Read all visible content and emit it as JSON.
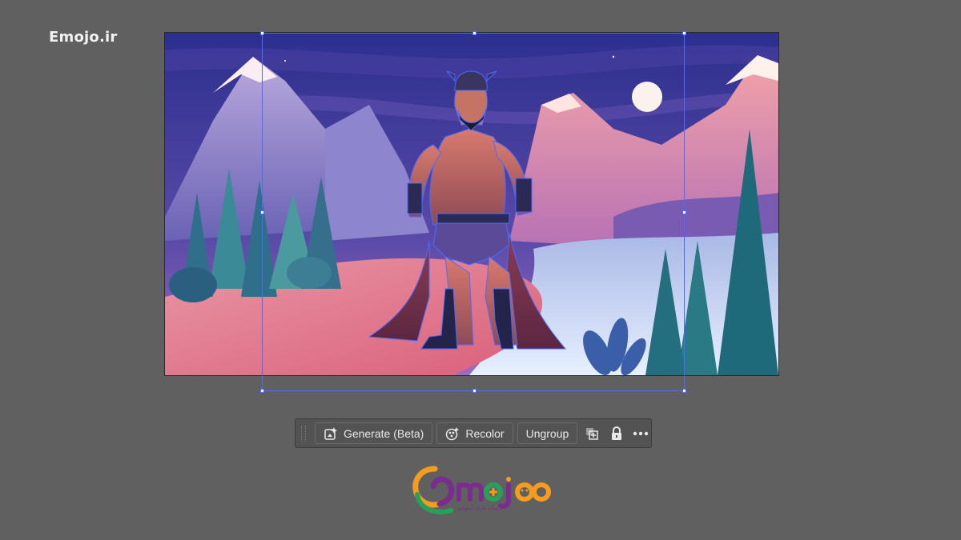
{
  "watermark": {
    "text": "Emojo.ir"
  },
  "toolbar": {
    "generate_label": "Generate (Beta)",
    "recolor_label": "Recolor",
    "ungroup_label": "Ungroup",
    "icons": [
      "arrange-icon",
      "lock-icon",
      "more-options-icon"
    ]
  },
  "logo": {
    "wordmark": "emojo",
    "tagline": "رسانه بازی ایموجو"
  },
  "colors": {
    "canvas": "#606060",
    "selection": "#4b6bff",
    "toolbar": "#535353"
  }
}
